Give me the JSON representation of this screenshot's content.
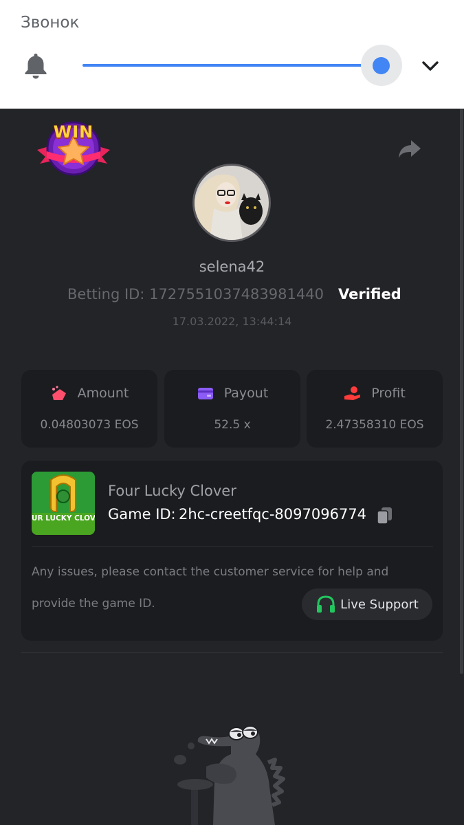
{
  "volume_panel": {
    "title": "Звонок",
    "level_percent": 100,
    "icons": {
      "bell": "bell-icon",
      "expand": "chevron-down-icon"
    },
    "accent_color": "#4285f4"
  },
  "bet": {
    "badge": {
      "text": "WIN",
      "icon": "win-star-badge-icon"
    },
    "share_icon": "share-icon",
    "avatar": "avatar",
    "username": "selena42",
    "betting_id_label": "Betting ID:",
    "betting_id": "1727551037483981440",
    "verified_label": "Verified",
    "timestamp": "17.03.2022, 13:44:14"
  },
  "stats": [
    {
      "label": "Amount",
      "value": "0.04803073 EOS",
      "icon": "amount-icon",
      "color": "#ff4f6d"
    },
    {
      "label": "Payout",
      "value": "52.5 x",
      "icon": "wallet-icon",
      "color": "#8b5cf6"
    },
    {
      "label": "Profit",
      "value": "2.47358310 EOS",
      "icon": "profit-hand-icon",
      "color": "#ff3b3b"
    }
  ],
  "game": {
    "name": "Four Lucky Clover",
    "thumb_text": "FOUR LUCKY CLOVER",
    "id_label": "Game ID:",
    "id": "2hc-creetfqc-8097096774",
    "copy_icon": "copy-icon",
    "support_line_1": "Any issues, please contact the customer service for help and",
    "support_line_2": "provide the game ID.",
    "live_support_label": "Live Support",
    "live_support_icon": "headset-icon",
    "live_support_icon_color": "#22c55e"
  },
  "footer": {
    "mascot": "crocodile-mascot"
  }
}
